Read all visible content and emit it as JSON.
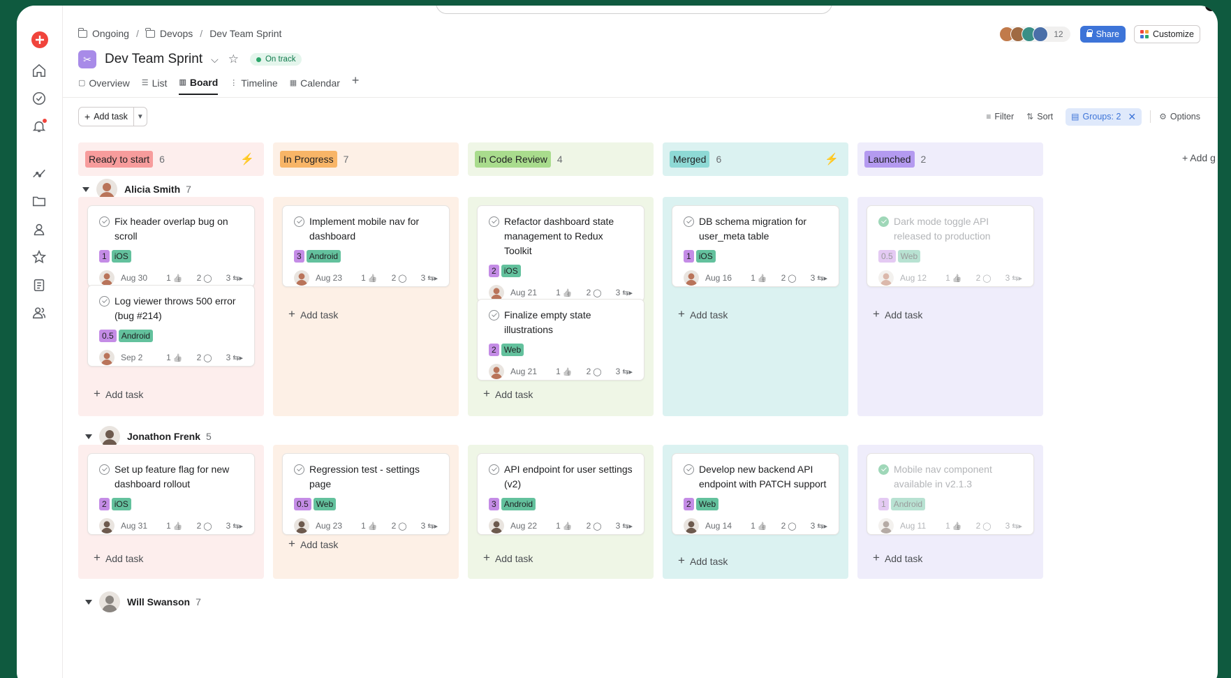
{
  "breadcrumb": {
    "items": [
      "Ongoing",
      "Devops",
      "Dev Team Sprint"
    ],
    "separator": "/"
  },
  "project": {
    "title": "Dev Team Sprint",
    "status": "On track"
  },
  "tabs": [
    {
      "label": "Overview",
      "icon": "overview-icon"
    },
    {
      "label": "List",
      "icon": "list-icon"
    },
    {
      "label": "Board",
      "icon": "board-icon",
      "active": true
    },
    {
      "label": "Timeline",
      "icon": "timeline-icon"
    },
    {
      "label": "Calendar",
      "icon": "calendar-icon"
    }
  ],
  "header": {
    "member_count": "12",
    "share_label": "Share",
    "customize_label": "Customize"
  },
  "toolbar": {
    "add_task_label": "Add task",
    "filter_label": "Filter",
    "sort_label": "Sort",
    "groups_label": "Groups: 2",
    "options_label": "Options"
  },
  "add_group_label": "+ Add g",
  "add_task_label": "Add task",
  "colors": {
    "accent": "#3d74d8",
    "brand_red": "#f0443c",
    "background": "#0f5a3f"
  },
  "columns": [
    {
      "label": "Ready to start",
      "count": "6",
      "tag_color": "#f79c9c",
      "bg": "#fdeeed",
      "bolt": true
    },
    {
      "label": "In Progress",
      "count": "7",
      "tag_color": "#f8b567",
      "bg": "#fdf0e6",
      "bolt": false
    },
    {
      "label": "In Code Review",
      "count": "4",
      "tag_color": "#a9dc8d",
      "bg": "#eff6e6",
      "bolt": false
    },
    {
      "label": "Merged",
      "count": "6",
      "tag_color": "#8ed9d5",
      "bg": "#dbf2f1",
      "bolt": true
    },
    {
      "label": "Launched",
      "count": "2",
      "tag_color": "#b49af0",
      "bg": "#efedfb",
      "bolt": false
    }
  ],
  "groups": [
    {
      "name": "Alicia Smith",
      "count": "7",
      "cards": [
        [
          {
            "title": "Fix header overlap bug on scroll",
            "points": "1",
            "os": "iOS",
            "date": "Aug 30",
            "likes": "1",
            "comments": "2",
            "subtasks": "3"
          },
          {
            "title": "Log viewer throws 500 error (bug #214)",
            "points": "0.5",
            "os": "Android",
            "date": "Sep 2",
            "likes": "1",
            "comments": "2",
            "subtasks": "3"
          }
        ],
        [
          {
            "title": "Implement mobile nav for dashboard",
            "points": "3",
            "os": "Android",
            "date": "Aug 23",
            "likes": "1",
            "comments": "2",
            "subtasks": "3"
          }
        ],
        [
          {
            "title": "Refactor dashboard state management to Redux Toolkit",
            "points": "2",
            "os": "iOS",
            "date": "Aug 21",
            "likes": "1",
            "comments": "2",
            "subtasks": "3"
          },
          {
            "title": "Finalize empty state illustrations",
            "points": "2",
            "os": "Web",
            "date": "Aug 21",
            "likes": "1",
            "comments": "2",
            "subtasks": "3"
          }
        ],
        [
          {
            "title": "DB schema migration for user_meta table",
            "points": "1",
            "os": "iOS",
            "date": "Aug 16",
            "likes": "1",
            "comments": "2",
            "subtasks": "3"
          }
        ],
        [
          {
            "title": "Dark mode toggle API released to production",
            "points": "0.5",
            "os": "Web",
            "date": "Aug 12",
            "likes": "1",
            "comments": "2",
            "subtasks": "3",
            "done": true
          }
        ]
      ]
    },
    {
      "name": "Jonathon Frenk",
      "count": "5",
      "cards": [
        [
          {
            "title": "Set up feature flag for new dashboard rollout",
            "points": "2",
            "os": "iOS",
            "date": "Aug 31",
            "likes": "1",
            "comments": "2",
            "subtasks": "3"
          }
        ],
        [
          {
            "title": "Regression test - settings page",
            "points": "0.5",
            "os": "Web",
            "date": "Aug 23",
            "likes": "1",
            "comments": "2",
            "subtasks": "3"
          }
        ],
        [
          {
            "title": "API endpoint for user settings (v2)",
            "points": "3",
            "os": "Android",
            "date": "Aug 22",
            "likes": "1",
            "comments": "2",
            "subtasks": "3"
          }
        ],
        [
          {
            "title": "Develop new backend API endpoint with PATCH support",
            "points": "2",
            "os": "Web",
            "date": "Aug 14",
            "likes": "1",
            "comments": "2",
            "subtasks": "3"
          }
        ],
        [
          {
            "title": "Mobile nav component available in v2.1.3",
            "points": "1",
            "os": "Android",
            "date": "Aug 11",
            "likes": "1",
            "comments": "2",
            "subtasks": "3",
            "done": true
          }
        ]
      ]
    },
    {
      "name": "Will Swanson",
      "count": "7",
      "cards": []
    }
  ]
}
